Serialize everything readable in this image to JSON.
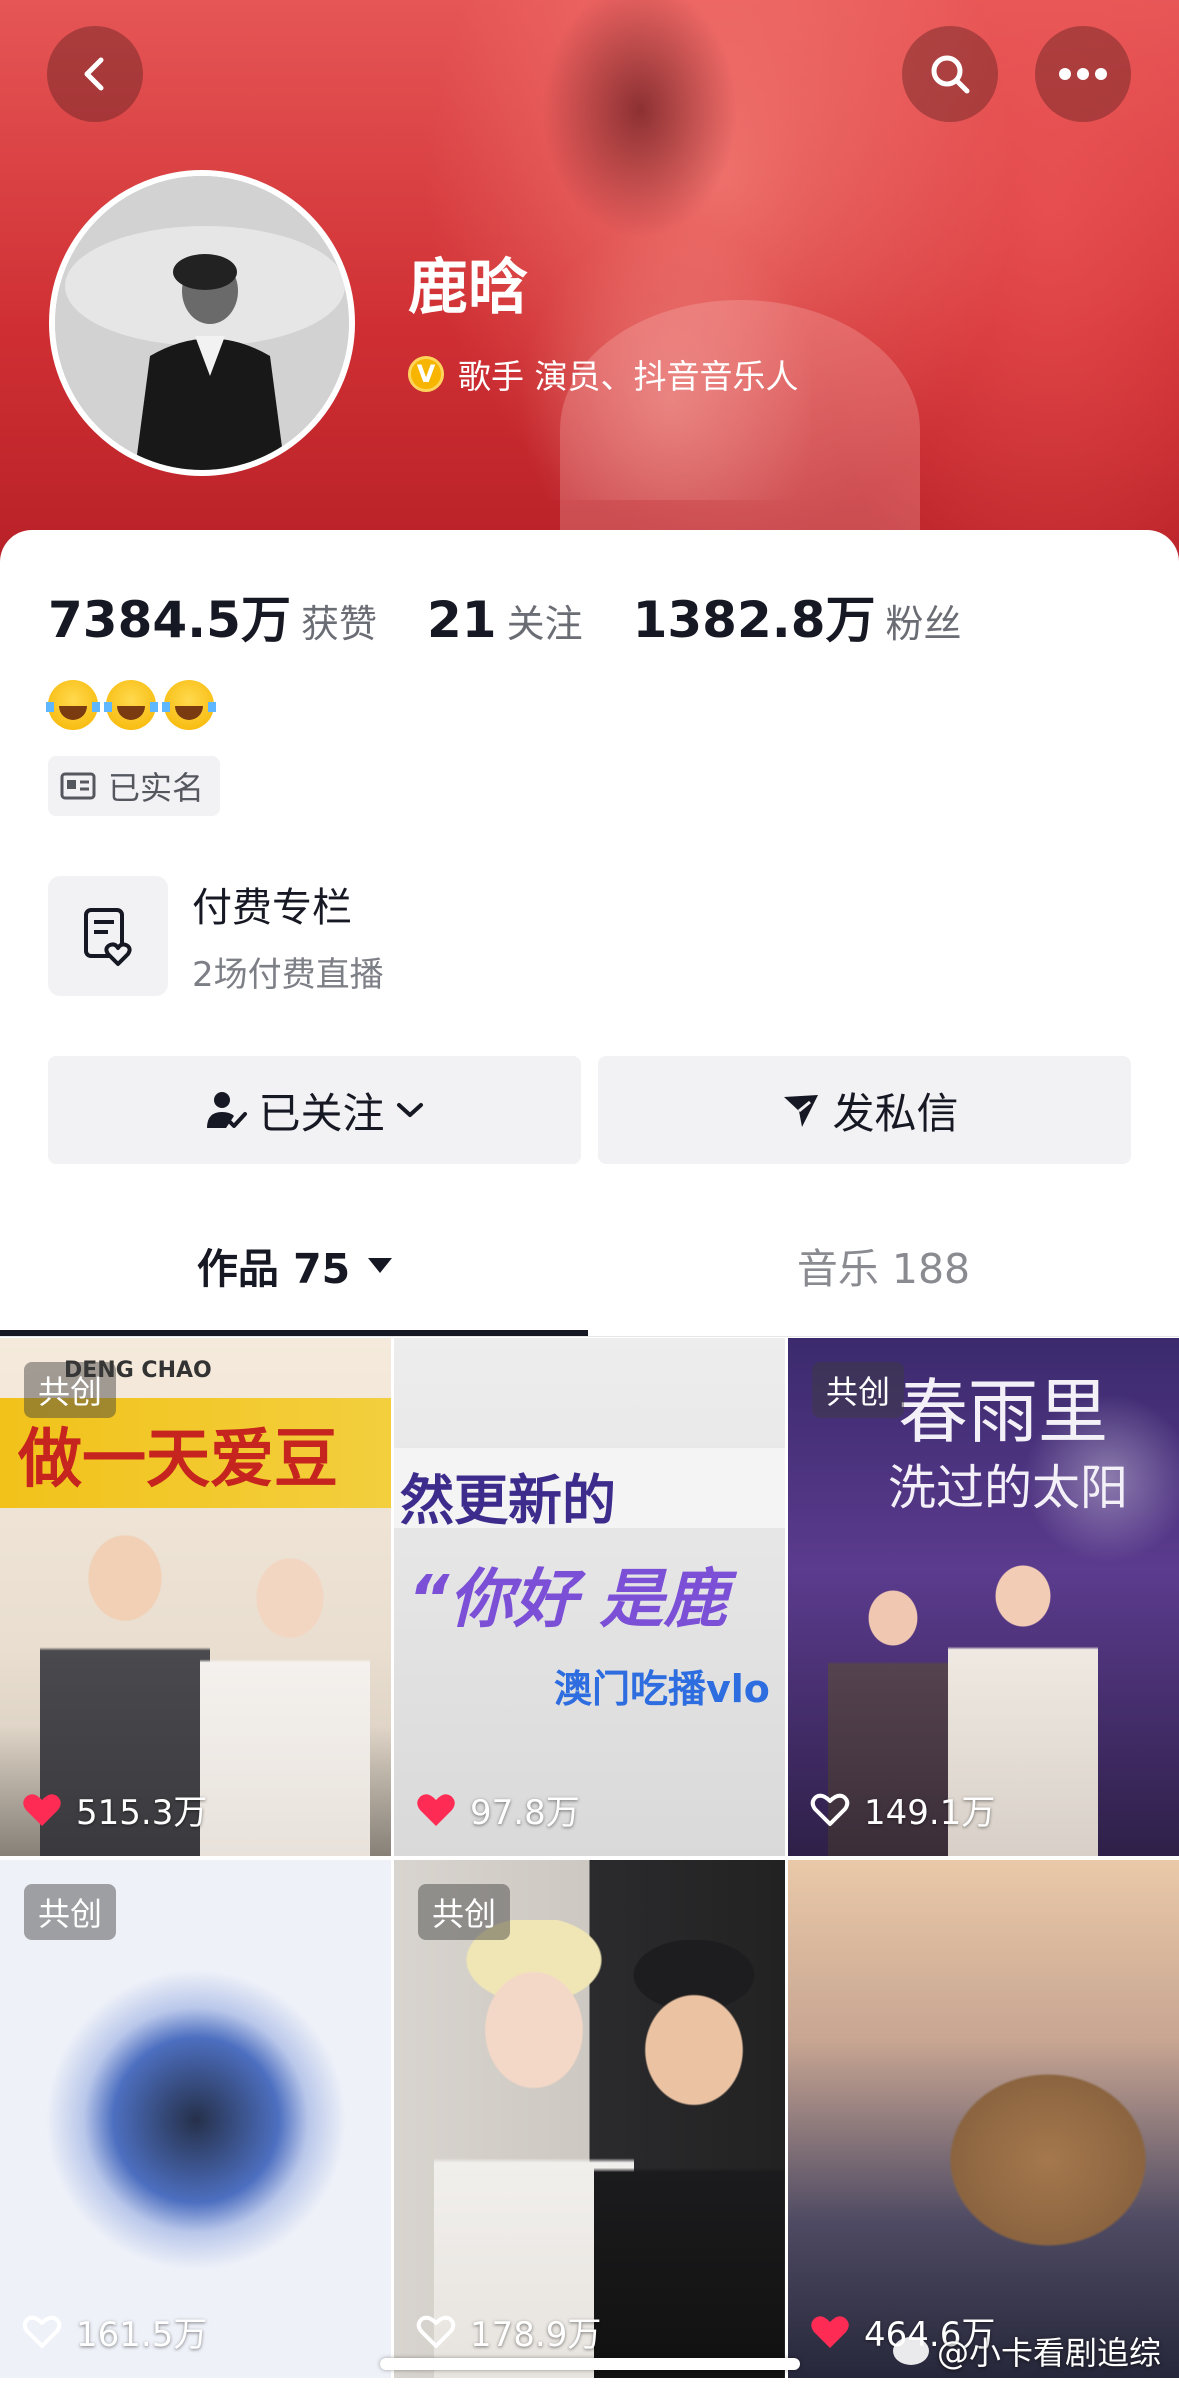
{
  "profile": {
    "name": "鹿晗",
    "verify_badge": "V",
    "verify_text": "歌手 演员、抖音音乐人"
  },
  "stats": {
    "likes_num": "7384.5万",
    "likes_label": "获赞",
    "following_num": "21",
    "following_label": "关注",
    "fans_num": "1382.8万",
    "fans_label": "粉丝"
  },
  "bio_emojis": [
    "face-with-tears-of-joy",
    "face-with-tears-of-joy",
    "face-with-tears-of-joy"
  ],
  "realname_label": "已实名",
  "paid_column": {
    "title": "付费专栏",
    "subtitle": "2场付费直播"
  },
  "actions": {
    "follow_label": "已关注",
    "message_label": "发私信"
  },
  "tabs": {
    "works_label": "作品 75",
    "music_label": "音乐 188"
  },
  "videos": [
    {
      "tag": "共创",
      "likes": "515.3万",
      "liked": true,
      "title_text": "做一天爱豆",
      "caption": "DENG CHAO"
    },
    {
      "tag": "",
      "likes": "97.8万",
      "liked": true,
      "title_text": "然更新的",
      "caption": "“你好 是鹿",
      "sub": "澳门吃播vlo"
    },
    {
      "tag": "共创",
      "likes": "149.1万",
      "liked": false,
      "title_text": "春雨里",
      "caption": "洗过的太阳"
    },
    {
      "tag": "共创",
      "likes": "161.5万",
      "liked": false
    },
    {
      "tag": "共创",
      "likes": "178.9万",
      "liked": false
    },
    {
      "tag": "",
      "likes": "464.6万",
      "liked": true
    }
  ],
  "watermark": "@小卡看剧追综",
  "colors": {
    "header_red": "#cf2f33",
    "like_red": "#fe2c55",
    "verify_gold": "#f7b500",
    "text_primary": "#161823",
    "text_secondary": "#6b6d75"
  }
}
